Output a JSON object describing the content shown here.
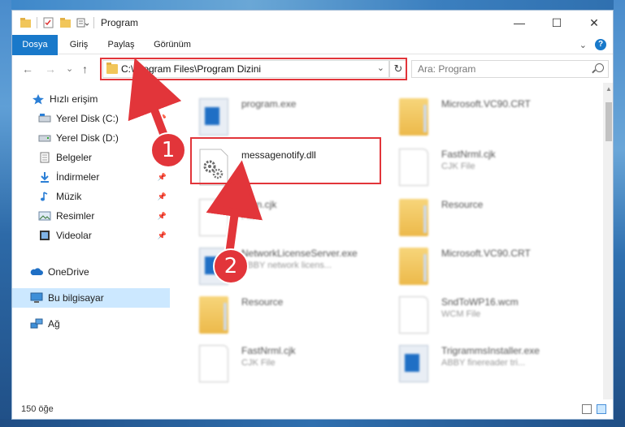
{
  "window": {
    "title": "Program",
    "controls": {
      "minimize": "—",
      "maximize": "☐",
      "close": "✕"
    }
  },
  "ribbon": {
    "tabs": [
      "Dosya",
      "Giriş",
      "Paylaş",
      "Görünüm"
    ],
    "expand": "⌄",
    "help": "?"
  },
  "nav": {
    "back": "←",
    "forward": "→",
    "recent": "⌄",
    "up": "↑",
    "address": "C:\\Program Files\\Program Dizini",
    "address_dropdown": "⌄",
    "refresh": "↻",
    "search_placeholder": "Ara: Program"
  },
  "sidebar": {
    "items": [
      {
        "label": "Hızlı erişim",
        "icon": "star-icon"
      },
      {
        "label": "Yerel Disk (C:)",
        "icon": "drive-icon",
        "pinned": true
      },
      {
        "label": "Yerel Disk (D:)",
        "icon": "drive-icon"
      },
      {
        "label": "Belgeler",
        "icon": "documents-icon"
      },
      {
        "label": "İndirmeler",
        "icon": "download-icon",
        "pinned": true
      },
      {
        "label": "Müzik",
        "icon": "music-icon",
        "pinned": true
      },
      {
        "label": "Resimler",
        "icon": "pictures-icon",
        "pinned": true
      },
      {
        "label": "Videolar",
        "icon": "videos-icon",
        "pinned": true
      },
      {
        "label": "OneDrive",
        "icon": "cloud-icon"
      },
      {
        "label": "Bu bilgisayar",
        "icon": "computer-icon",
        "selected": true
      },
      {
        "label": "Ağ",
        "icon": "network-icon"
      }
    ],
    "pin_glyph": "📌"
  },
  "files": [
    {
      "name": "program.exe",
      "sub": "",
      "type": "exe"
    },
    {
      "name": "Microsoft.VC90.CRT",
      "sub": "",
      "type": "folder"
    },
    {
      "name": "messagenotify.dll",
      "sub": "",
      "type": "dll"
    },
    {
      "name": "FastNrml.cjk",
      "sub": "CJK File",
      "type": "doc"
    },
    {
      "name": "Korn.cjk",
      "sub": "File",
      "type": "doc"
    },
    {
      "name": "Resource",
      "sub": "",
      "type": "folder"
    },
    {
      "name": "NetworkLicenseServer.exe",
      "sub": "ABBY network licens...",
      "type": "exe"
    },
    {
      "name": "Microsoft.VC90.CRT",
      "sub": "",
      "type": "folder"
    },
    {
      "name": "Resource",
      "sub": "",
      "type": "folder"
    },
    {
      "name": "SndToWP16.wcm",
      "sub": "WCM File",
      "type": "doc"
    },
    {
      "name": "FastNrml.cjk",
      "sub": "CJK File",
      "type": "doc"
    },
    {
      "name": "TrigrammsInstaller.exe",
      "sub": "ABBY finereader tri...",
      "type": "exe"
    }
  ],
  "status": {
    "count": "150 öğe"
  },
  "annotations": {
    "badge1": "1",
    "badge2": "2",
    "color": "#e2353a"
  }
}
